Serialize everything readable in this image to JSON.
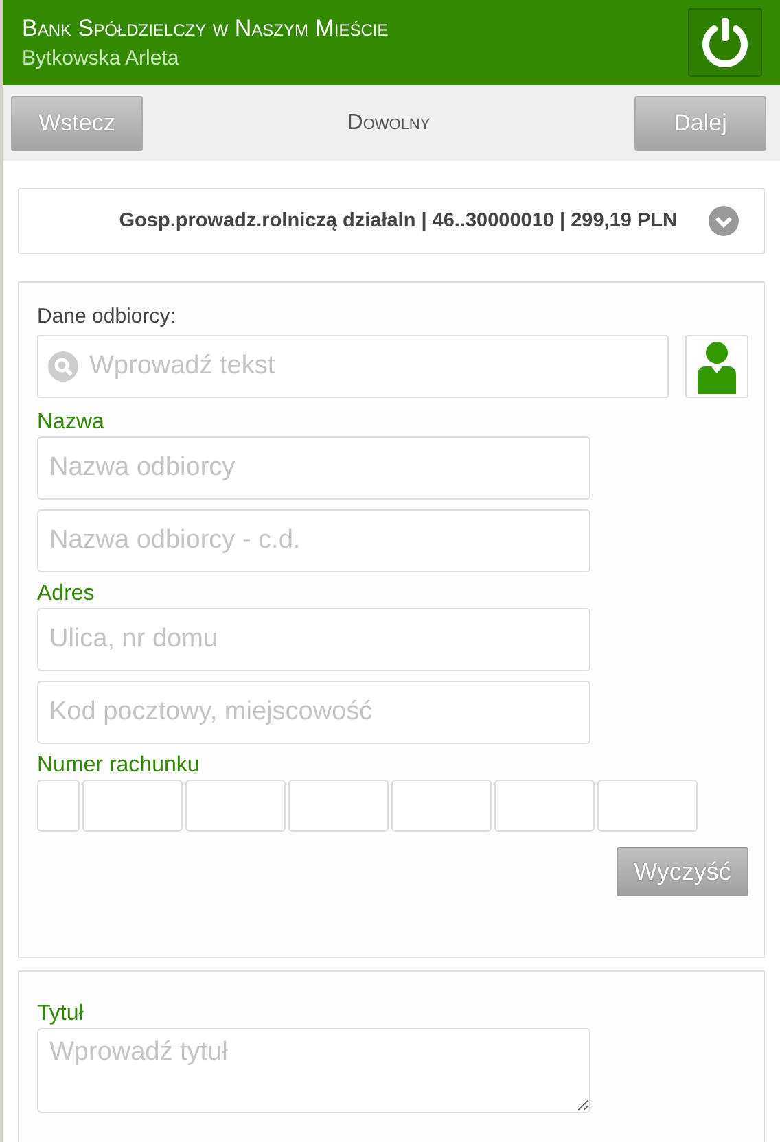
{
  "header": {
    "bank_name": "Bank Spółdzielczy w Naszym Mieście",
    "user_name": "Bytkowska Arleta"
  },
  "nav": {
    "back": "Wstecz",
    "title": "Dowolny",
    "next": "Dalej"
  },
  "account_select": {
    "value": "Gosp.prowadz.rolniczą działaln | 46..30000010 | 299,19 PLN"
  },
  "recipient": {
    "label": "Dane odbiorcy:",
    "search_placeholder": "Wprowadź tekst",
    "sections": [
      {
        "heading": "Nazwa",
        "fields": [
          {
            "placeholder": "Nazwa odbiorcy"
          },
          {
            "placeholder": "Nazwa odbiorcy - c.d."
          }
        ]
      },
      {
        "heading": "Adres",
        "fields": [
          {
            "placeholder": "Ulica, nr domu"
          },
          {
            "placeholder": "Kod pocztowy, miejscowość"
          }
        ]
      }
    ],
    "account_heading": "Numer rachunku",
    "account_segments": [
      {
        "kind": "short"
      },
      {
        "kind": "long"
      },
      {
        "kind": "long"
      },
      {
        "kind": "long"
      },
      {
        "kind": "long"
      },
      {
        "kind": "long"
      },
      {
        "kind": "long"
      }
    ],
    "clear_button": "Wyczyść"
  },
  "title_section": {
    "heading": "Tytuł",
    "placeholder": "Wprowadź tytuł"
  }
}
